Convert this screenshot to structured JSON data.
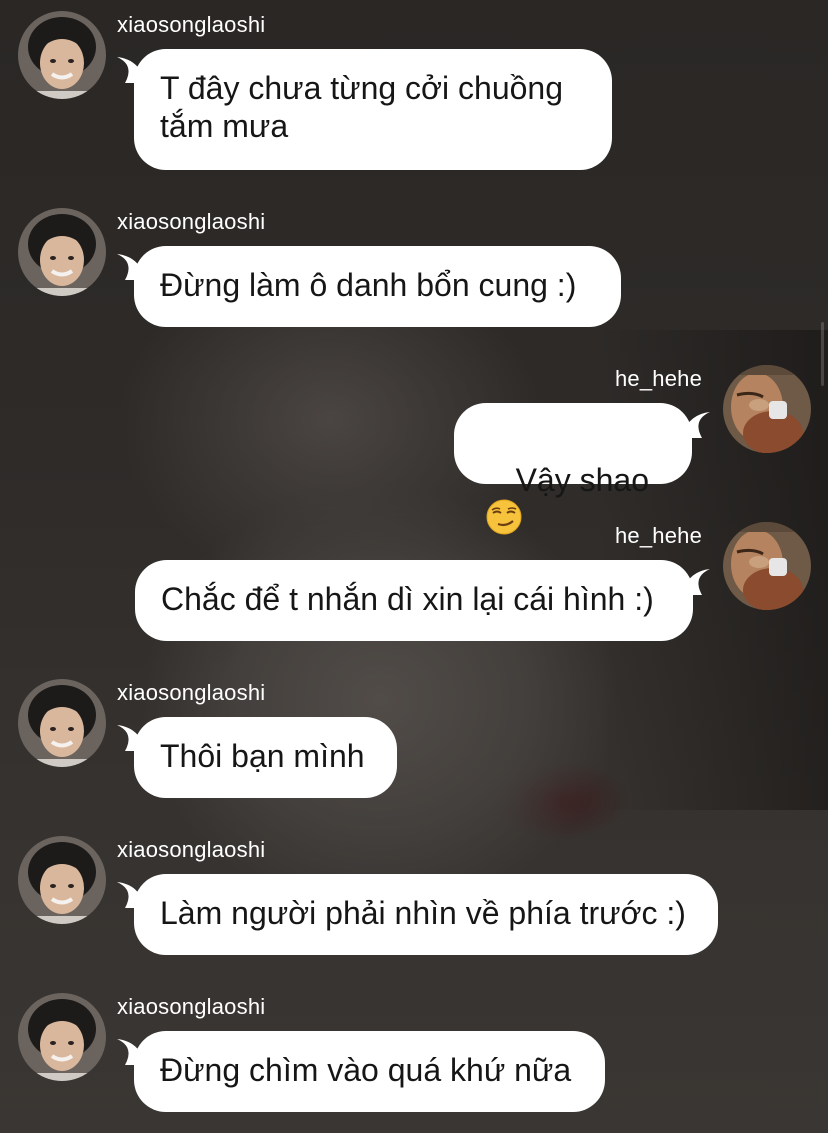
{
  "users": {
    "left": "xiaosonglaoshi",
    "right": "he_hehe"
  },
  "messages": [
    {
      "username": "xiaosonglaoshi",
      "text": "T đây chưa từng cởi chuồng\ntắm mưa"
    },
    {
      "username": "xiaosonglaoshi",
      "text": "Đừng làm ô danh bổn cung :)"
    },
    {
      "username": "he_hehe",
      "text": "Vậy shao",
      "emoji": "smirking-face-emoji"
    },
    {
      "username": "he_hehe",
      "text": "Chắc để t nhắn dì xin lại cái hình :)"
    },
    {
      "username": "xiaosonglaoshi",
      "text": "Thôi bạn mình"
    },
    {
      "username": "xiaosonglaoshi",
      "text": "Làm người phải nhìn về phía trước :)"
    },
    {
      "username": "xiaosonglaoshi",
      "text": "Đừng chìm vào quá khứ nữa"
    }
  ],
  "colors": {
    "bubble": "#ffffff",
    "text": "#161616",
    "username": "#ffffff"
  }
}
